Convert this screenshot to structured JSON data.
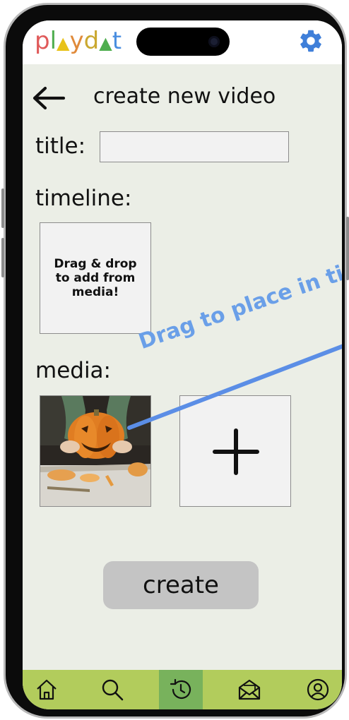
{
  "header": {
    "logo_letters": [
      {
        "char": "p",
        "color": "#e05a5a"
      },
      {
        "char": "l",
        "color": "#4fae4f"
      },
      {
        "char": "▲",
        "color": "#e8c21a"
      },
      {
        "char": "y",
        "color": "#e08a3a"
      },
      {
        "char": "d",
        "color": "#caa830"
      },
      {
        "char": "▲",
        "color": "#4fae4f"
      },
      {
        "char": "t",
        "color": "#4a8ee0"
      }
    ],
    "settings_icon": "gear-icon"
  },
  "page": {
    "back_icon": "arrow-left-icon",
    "heading": "create new video",
    "title_label": "title:",
    "title_value": "",
    "timeline_label": "timeline:",
    "drop_hint": "Drag & drop to add from media!",
    "media_label": "media:",
    "add_media_icon": "plus-icon",
    "create_label": "create",
    "annotation": "Drag to place in ti"
  },
  "nav": {
    "items": [
      "home-icon",
      "search-icon",
      "history-icon",
      "inbox-icon",
      "profile-icon"
    ],
    "active": "history-icon"
  },
  "colors": {
    "background": "#ebeee6",
    "navbar": "#b2cc5c",
    "nav_active": "#78b25c",
    "accent_gear": "#3f7fd9",
    "annotation": "#6a9fe8",
    "button": "#c4c4c4"
  }
}
